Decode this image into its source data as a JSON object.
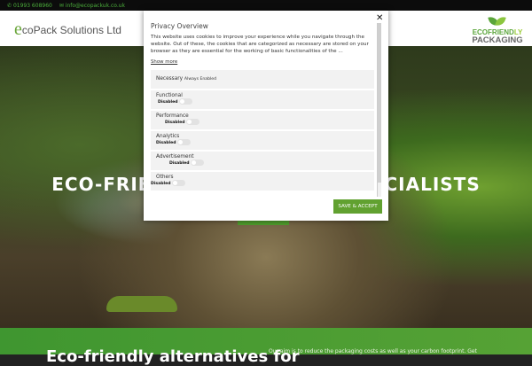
{
  "topbar": {
    "phone": "01993 608960",
    "email": "info@ecopackuk.co.uk"
  },
  "header": {
    "logo_e": "e",
    "logo_text": "coPack Solutions Ltd",
    "badge_line1a": "ECOFRIEND",
    "badge_line1b": "LY",
    "badge_line2": "PACKAGING"
  },
  "hero": {
    "title": "ECO-FRIENDLY PACKAGING SPECIALISTS"
  },
  "band": {
    "heading": "Eco-friendly alternatives for",
    "text": "Our aim is to reduce the packaging costs as well as your carbon footprint. Get"
  },
  "modal": {
    "close": "✕",
    "title": "Privacy Overview",
    "description": "This website uses cookies to improve your experience while you navigate through the website. Out of these, the cookies that are categorized as necessary are stored on your browser as they are essential for the working of basic functionalities of the ...",
    "show_more": "Show more",
    "necessary": {
      "label": "Necessary",
      "status": "Always Enabled"
    },
    "categories": [
      {
        "label": "Functional",
        "status": "Disabled"
      },
      {
        "label": "Performance",
        "status": "Disabled"
      },
      {
        "label": "Analytics",
        "status": "Disabled"
      },
      {
        "label": "Advertisement",
        "status": "Disabled"
      },
      {
        "label": "Others",
        "status": "Disabled"
      }
    ],
    "save_label": "SAVE & ACCEPT"
  }
}
